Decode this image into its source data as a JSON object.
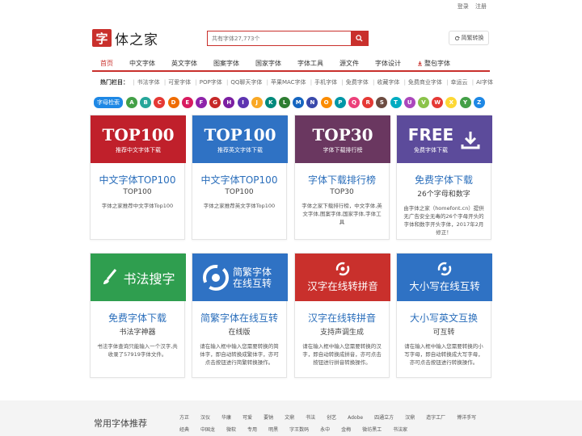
{
  "topbar": {
    "login": "登录",
    "register": "注册"
  },
  "logo": {
    "mark": "字",
    "text": "体之家"
  },
  "search": {
    "placeholder": "共有字体27,773个"
  },
  "convert_button": {
    "label": "简繁转换"
  },
  "nav": [
    "首页",
    "中文字体",
    "英文字体",
    "图案字体",
    "国家字体",
    "字体工具",
    "源文件",
    "字体设计",
    "整包字体"
  ],
  "hot": {
    "label": "热门栏目：",
    "items": [
      "书法字体",
      "可爱字体",
      "POP字体",
      "QQ聊天字体",
      "苹果MAC字体",
      "手机字体",
      "免费字体",
      "收藏字体",
      "免费商业字体",
      "幸运云",
      "AI字体"
    ]
  },
  "alphabet": {
    "title": "字母检索",
    "letters": [
      "A",
      "B",
      "C",
      "D",
      "E",
      "F",
      "G",
      "H",
      "I",
      "J",
      "K",
      "L",
      "M",
      "N",
      "O",
      "P",
      "Q",
      "R",
      "S",
      "T",
      "U",
      "V",
      "W",
      "X",
      "Y",
      "Z"
    ],
    "colors": [
      "#43a047",
      "#26a69a",
      "#e53935",
      "#ef6c00",
      "#d81b60",
      "#8e24aa",
      "#c62828",
      "#7b1fa2",
      "#5e35b1",
      "#f9a825",
      "#00897b",
      "#2e7d32",
      "#1565c0",
      "#3949ab",
      "#fb8c00",
      "#0097a7",
      "#ec407a",
      "#e53935",
      "#6d4c41",
      "#00acc1",
      "#ab47bc",
      "#8bc34a",
      "#e53935",
      "#fdd835",
      "#43a047",
      "#1e88e5"
    ]
  },
  "cards": [
    {
      "banner_big": "TOP100",
      "banner_small": "推荐中文字体下载",
      "title": "中文字体TOP100",
      "sub": "TOP100",
      "desc": "字体之家推荐中文字体Top100",
      "color": "#c0202b"
    },
    {
      "banner_big": "TOP100",
      "banner_small": "推荐英文字体下载",
      "title": "中文字体TOP100",
      "sub": "TOP100",
      "desc": "字体之家推荐英文字体Top100",
      "color": "#2f72c4"
    },
    {
      "banner_big": "TOP30",
      "banner_small": "字体下载排行榜",
      "title": "字体下载排行榜",
      "sub": "TOP30",
      "desc": "字体之家下载排行榜，中文字体,英文字体,图案字体,国家字体,字体工具",
      "color": "#6a3760"
    },
    {
      "banner_big": "FREE",
      "banner_small": "免费字体下载",
      "title": "免费字体下载",
      "sub": "26个字母和数字",
      "desc": "由字体之家（homefont.cn）提供无广告安全无毒的26个字母开头的字体和数字开头字体，2017年2月修正！",
      "color": "#5c4b9b"
    },
    {
      "banner_big": "书法搜字",
      "banner_small": "",
      "title": "免费字体下载",
      "sub": "书法字神器",
      "desc": "书法字体查询只能输入一个汉字,共收录了57919字体文件。",
      "color": "#2f9e4f"
    },
    {
      "banner_big": "简繁字体在线互转",
      "banner_small": "",
      "title": "简繁字体在线互转",
      "sub": "在线版",
      "desc": "请在输入框中输入您需要转换的简体字，即自动转换成繁体字，亦可点击按钮进行简繁转换操作。",
      "color": "#2f72c4"
    },
    {
      "banner_big": "汉字在线转拼音",
      "banner_small": "",
      "title": "汉字在线转拼音",
      "sub": "支持声调生成",
      "desc": "请在输入框中输入您需要转换的汉字，即自动转换成拼音，亦可点击按钮进行拼音转换操作。",
      "color": "#c9302c"
    },
    {
      "banner_big": "大小写在线互转",
      "banner_small": "",
      "title": "大小写英文互换",
      "sub": "可互转",
      "desc": "请在输入框中输入您需要转换的小写字母，即自动转换成大写字母，亦可点击按钮进行转换操作。",
      "color": "#2f72c4"
    }
  ],
  "footer": {
    "title": "常用字体推荐",
    "links": [
      "方正",
      "汉仪",
      "华康",
      "可爱",
      "要钠",
      "文鼎",
      "书法",
      "创艺",
      "Adobe",
      "四通立方",
      "汉鼎",
      "造字工厂",
      "博洋手写",
      "经典",
      "中国龙",
      "微软",
      "专用",
      "明黑",
      "字王数码",
      "永中",
      "金梅",
      "微坊黑工",
      "书法家"
    ]
  }
}
